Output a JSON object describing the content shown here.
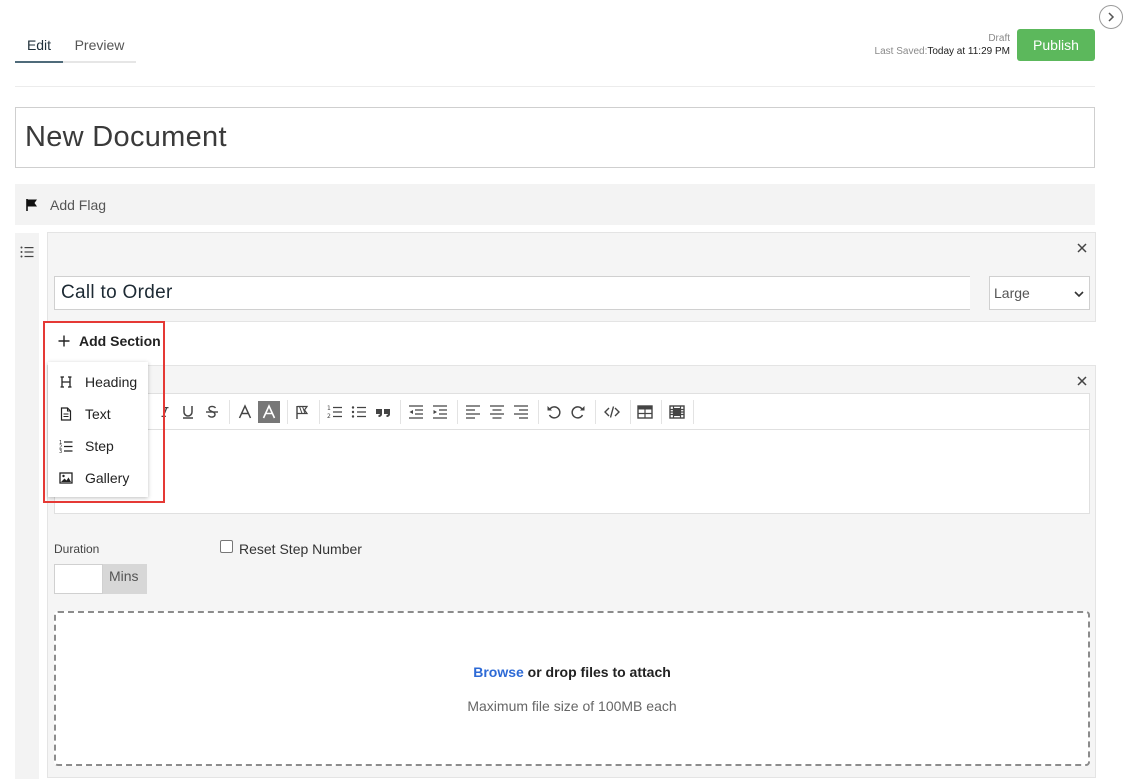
{
  "header": {
    "tabs": [
      {
        "label": "Edit",
        "active": true
      },
      {
        "label": "Preview",
        "active": false
      }
    ],
    "status": {
      "state": "Draft",
      "last_saved_label": "Last Saved:",
      "last_saved_value": "Today at 11:29 PM"
    },
    "publish_label": "Publish",
    "publish_color": "#5cb85c"
  },
  "document": {
    "title": "New Document"
  },
  "flag": {
    "label": "Add Flag"
  },
  "section_heading": {
    "value": "Call to Order",
    "size_selected": "Large"
  },
  "add_section": {
    "label": "Add Section",
    "menu": [
      {
        "label": "Heading",
        "icon": "heading-icon"
      },
      {
        "label": "Text",
        "icon": "document-icon"
      },
      {
        "label": "Step",
        "icon": "ordered-list-icon"
      },
      {
        "label": "Gallery",
        "icon": "image-icon"
      }
    ]
  },
  "step_section": {
    "duration_label": "Duration",
    "duration_value": "",
    "duration_unit": "Mins",
    "reset_label": "Reset Step Number",
    "reset_checked": false
  },
  "attachments": {
    "browse_label": "Browse",
    "drop_label": " or drop files to attach",
    "max_size": "Maximum file size of 100MB each"
  },
  "colors": {
    "accent_link": "#2d6ad6",
    "highlight": "#e53935"
  }
}
